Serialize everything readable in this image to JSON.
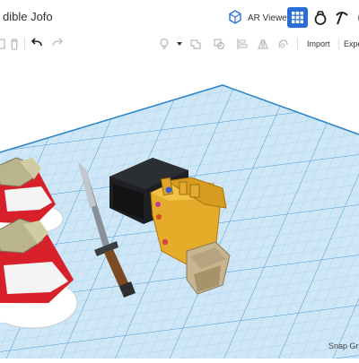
{
  "header": {
    "title": "dible Jofo",
    "ar_viewer_label": "AR Viewer",
    "icons": [
      "cube-view-icon",
      "grid-view-icon",
      "ring-icon",
      "pickaxe-icon",
      "avatar-icon"
    ]
  },
  "toolbar": {
    "tools": [
      "copy-icon",
      "trash-icon",
      "undo-icon",
      "redo-icon",
      "bulb-icon",
      "shape-icon",
      "group-icon",
      "mirror-icon",
      "align-icon",
      "flip-icon"
    ],
    "import_label": "Import",
    "export_label": "Expo"
  },
  "workplane": {
    "snap_label": "Snap Gri",
    "grid_color": "#4ba4dd",
    "objects": [
      "sneaker-top",
      "sneaker-bottom",
      "dagger",
      "black-box",
      "gauntlet"
    ]
  },
  "colors": {
    "accent": "#2a6fd6",
    "plane": "#cfe6f6"
  }
}
